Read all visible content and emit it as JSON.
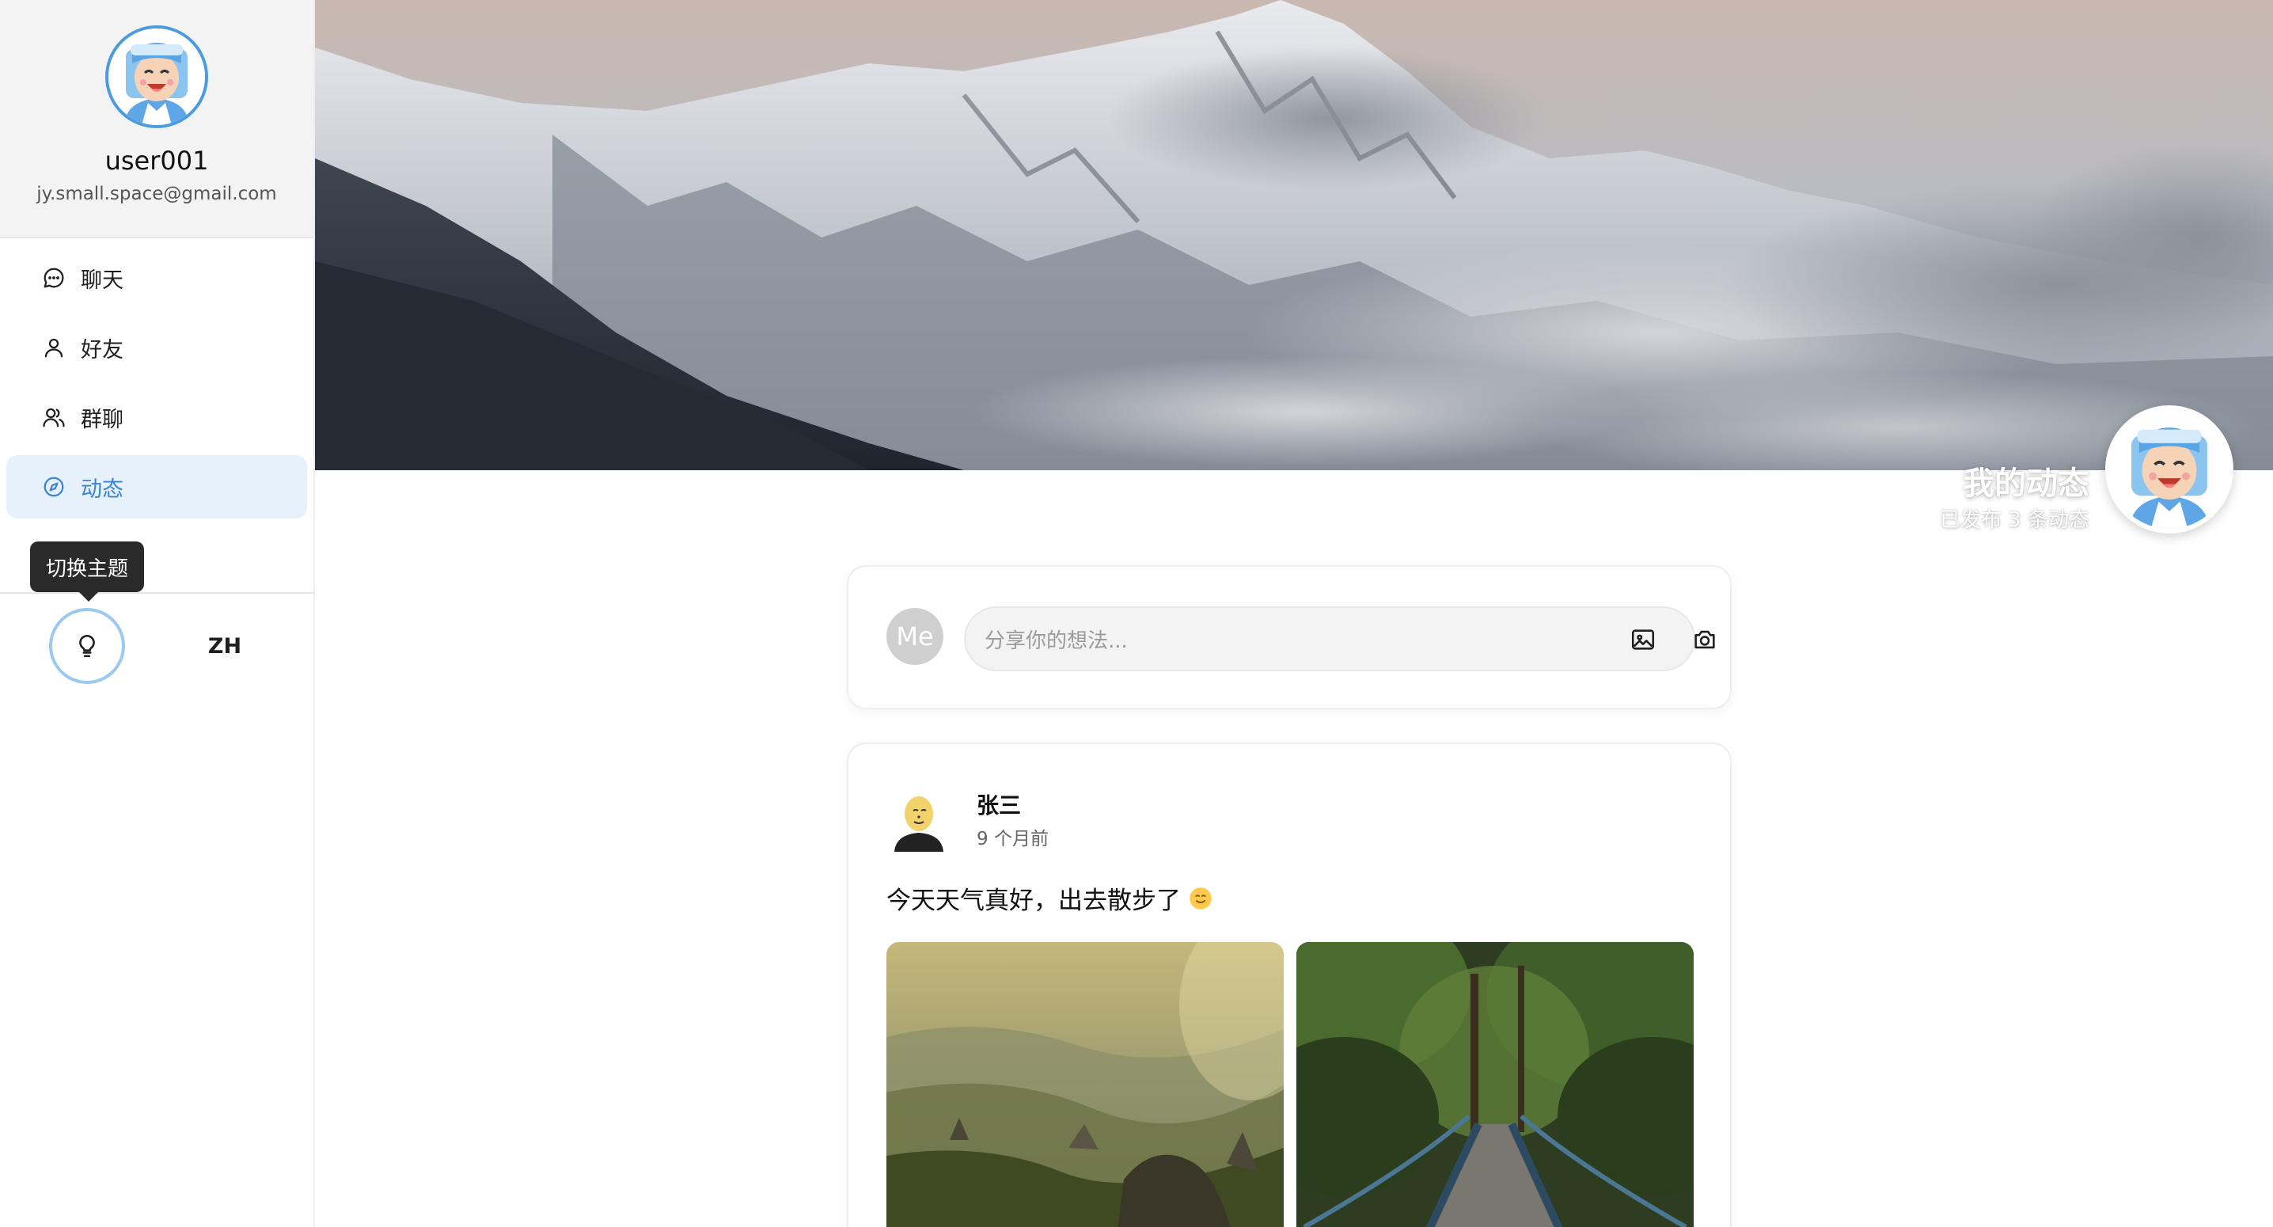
{
  "user": {
    "name": "user001",
    "email": "jy.small.space@gmail.com",
    "avatar_icon": "cartoon-avatar-icon"
  },
  "sidebar": {
    "items": [
      {
        "label": "聊天",
        "icon": "chat-bubble-icon",
        "active": false
      },
      {
        "label": "好友",
        "icon": "user-icon",
        "active": false
      },
      {
        "label": "群聊",
        "icon": "users-icon",
        "active": false
      },
      {
        "label": "动态",
        "icon": "compass-icon",
        "active": true
      }
    ],
    "tooltip": "切换主题",
    "theme_icon": "lightbulb-icon",
    "lang_label": "ZH"
  },
  "banner": {
    "title": "我的动态",
    "subtitle": "已发布 3 条动态"
  },
  "composer": {
    "avatar_label": "Me",
    "placeholder": "分享你的想法...",
    "image_icon": "image-icon",
    "camera_icon": "camera-icon"
  },
  "post": {
    "author": "张三",
    "time": "9 个月前",
    "text": "今天天气真好，出去散步了",
    "emoji": "smile-emoji-icon",
    "images": [
      "mountain-valley-photo",
      "forest-bridge-photo"
    ]
  },
  "colors": {
    "accent": "#3a84d3",
    "active_bg": "#e6f1fc",
    "avatar_border": "#4a9be0",
    "tooltip_bg": "#2a2a2a"
  }
}
